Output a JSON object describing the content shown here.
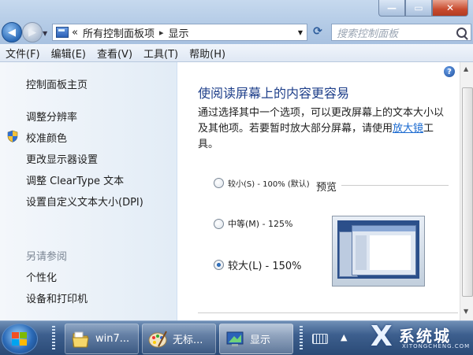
{
  "window": {
    "minimize_symbol": "—",
    "maximize_symbol": "▭",
    "close_symbol": "✕"
  },
  "address": {
    "prefix": "«",
    "crumbs": [
      "所有控制面板项",
      "显示"
    ],
    "separator": "▸"
  },
  "search": {
    "placeholder": "搜索控制面板"
  },
  "menu": [
    "文件(F)",
    "编辑(E)",
    "查看(V)",
    "工具(T)",
    "帮助(H)"
  ],
  "sidebar": {
    "home": "控制面板主页",
    "links": [
      "调整分辨率",
      "校准颜色",
      "更改显示器设置",
      "调整 ClearType 文本",
      "设置自定义文本大小(DPI)"
    ],
    "see_also_title": "另请参阅",
    "see_also": [
      "个性化",
      "设备和打印机"
    ]
  },
  "main": {
    "title": "使阅读屏幕上的内容更容易",
    "description_before": "通过选择其中一个选项，可以更改屏幕上的文本大小以及其他项。若要暂时放大部分屏幕，请使用",
    "description_link": "放大镜",
    "description_after": "工具。",
    "options": [
      {
        "label": "较小(S) - 100% (默认)",
        "selected": false
      },
      {
        "label": "中等(M) - 125%",
        "selected": false
      },
      {
        "label": "较大(L) - 150%",
        "selected": true
      }
    ],
    "preview_label": "预览"
  },
  "taskbar": {
    "items": [
      {
        "label": "win7...",
        "icon": "folder-icon"
      },
      {
        "label": "无标...",
        "icon": "paint-icon"
      },
      {
        "label": "显示",
        "icon": "display-icon",
        "active": true
      }
    ]
  },
  "brand": {
    "letter": "X",
    "name": "系统城",
    "url": "XITONGCHENG.COM"
  }
}
